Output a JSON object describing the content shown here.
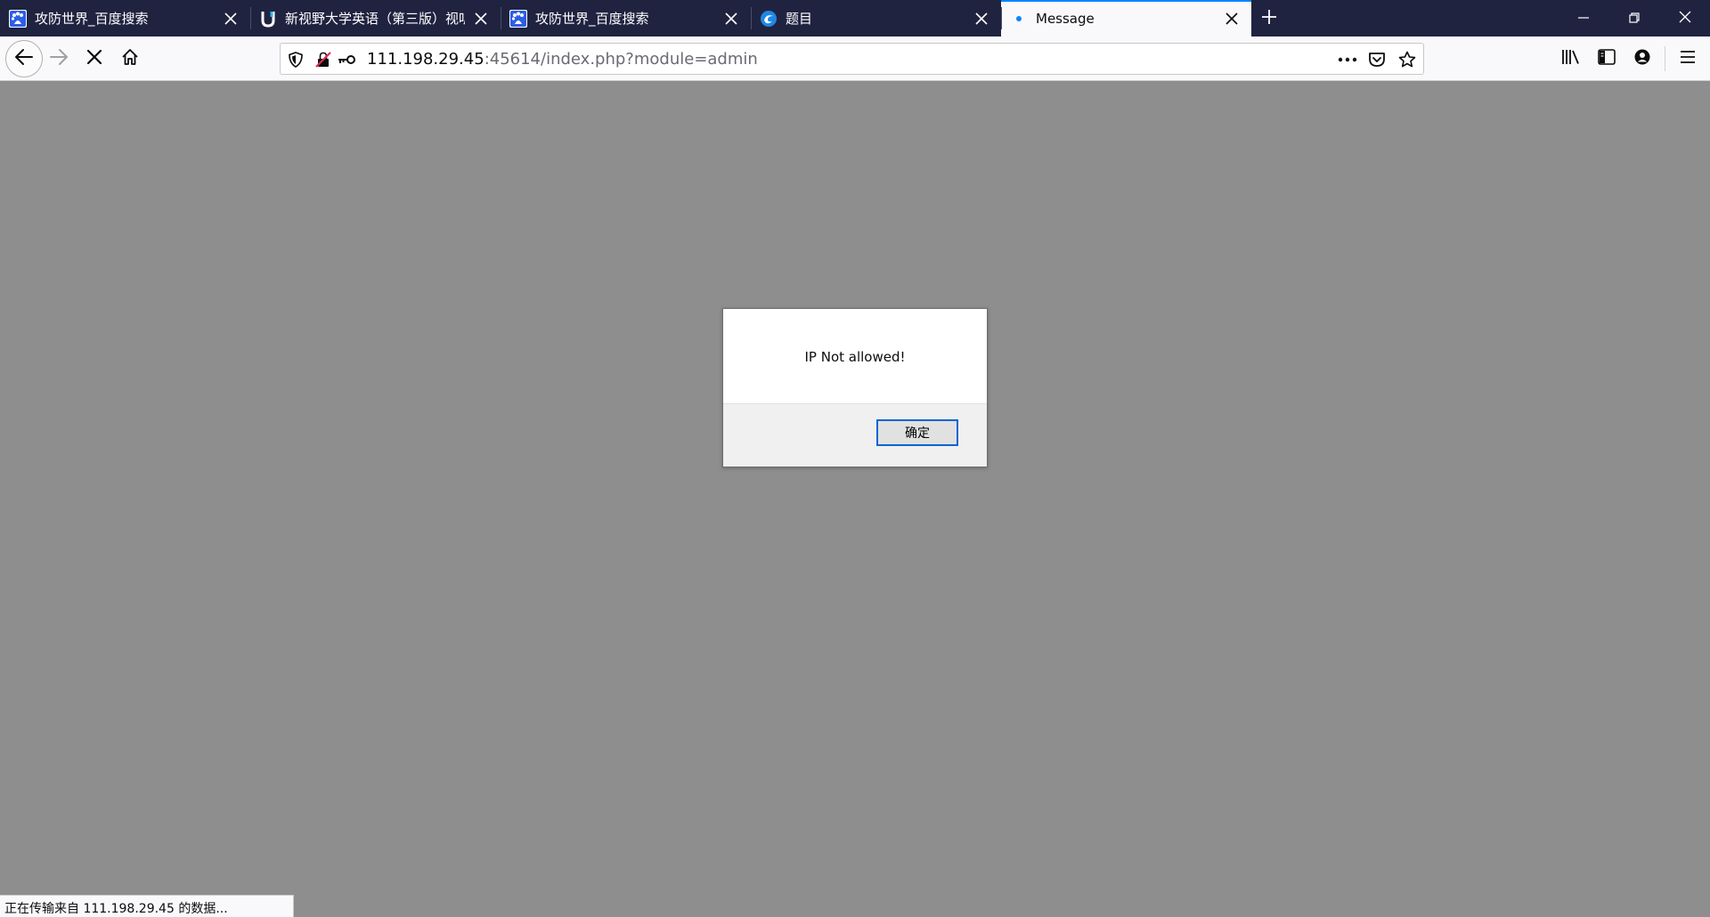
{
  "tabs": [
    {
      "title": "攻防世界_百度搜索",
      "favicon": "baidu-paw-icon"
    },
    {
      "title": "新视野大学英语（第三版）视听",
      "favicon": "u-logo-icon"
    },
    {
      "title": "攻防世界_百度搜索",
      "favicon": "baidu-paw-icon"
    },
    {
      "title": "题目",
      "favicon": "swirl-logo-icon"
    },
    {
      "title": "Message",
      "favicon": "loading-dot-icon",
      "active": true
    }
  ],
  "address": {
    "host": "111.198.29.45",
    "rest": ":45614/index.php?module=admin"
  },
  "dialog": {
    "message": "IP Not allowed!",
    "ok_label": "确定"
  },
  "status": {
    "text": "正在传输来自 111.198.29.45 的数据..."
  },
  "colors": {
    "tabstrip": "#202340",
    "active_tab_accent": "#0a84ff",
    "content_overlay": "#8e8e8e",
    "dialog_button_border": "#0a64d6"
  }
}
